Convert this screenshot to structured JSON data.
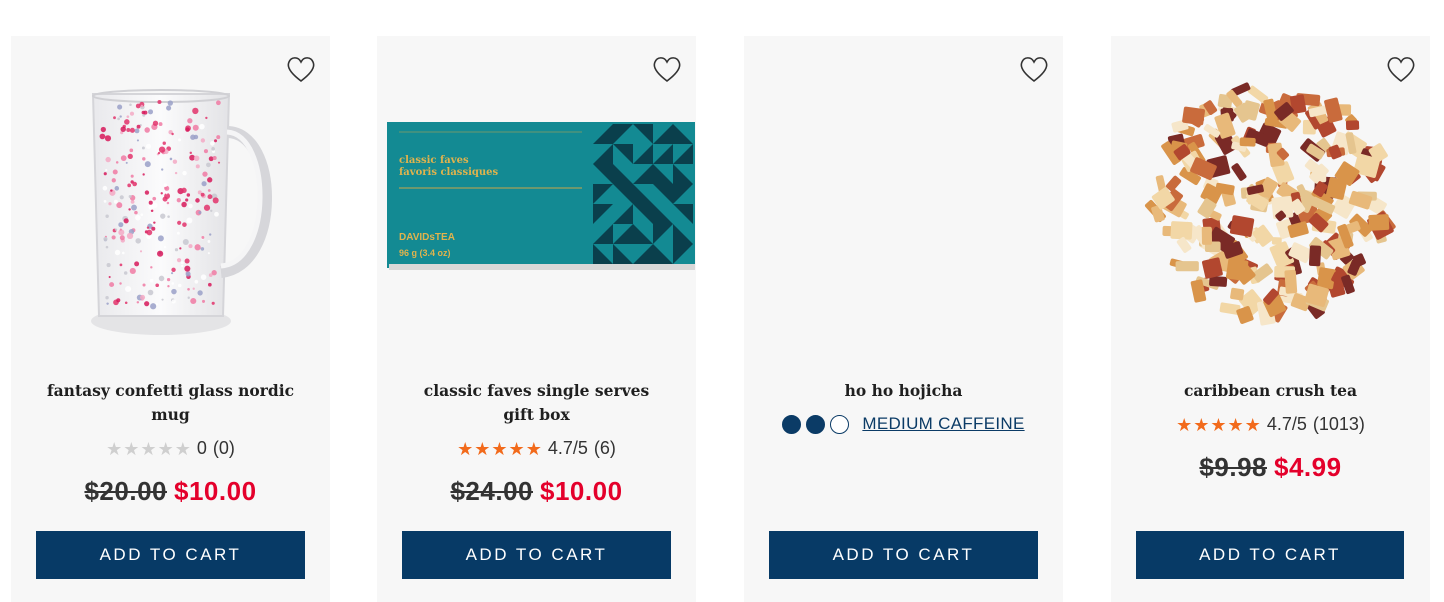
{
  "products": [
    {
      "title": "fantasy confetti glass nordic mug",
      "rating_value": "0",
      "rating_count": "(0)",
      "stars_filled": 0,
      "price_old": "$20.00",
      "price_new": "$10.00",
      "cta": "ADD TO CART",
      "image": "confetti-glass-mug"
    },
    {
      "title": "classic faves single serves gift box",
      "rating_value": "4.7/5",
      "rating_count": "(6)",
      "stars_filled": 4.7,
      "price_old": "$24.00",
      "price_new": "$10.00",
      "cta": "ADD TO CART",
      "image": "teal-gift-box",
      "box_title": "classic faves\nfavoris classiques",
      "box_brand": "DAVIDsTEA",
      "box_weight": "96 g (3.4 oz)"
    },
    {
      "title": "ho ho hojicha",
      "caffeine_label": "MEDIUM CAFFEINE",
      "caffeine_level": 2,
      "caffeine_max": 3,
      "cta": "ADD TO CART"
    },
    {
      "title": "caribbean crush tea",
      "rating_value": "4.7/5",
      "rating_count": "(1013)",
      "stars_filled": 4.7,
      "price_old": "$9.98",
      "price_new": "$4.99",
      "cta": "ADD TO CART",
      "image": "loose-leaf-fruit-tea"
    }
  ],
  "colors": {
    "card_bg": "#f7f7f7",
    "button_bg": "#073a66",
    "sale_price": "#e4002b",
    "star": "#f26a1b",
    "caffeine": "#0b3b66"
  },
  "icons": {
    "wishlist": "heart-outline-icon",
    "star": "star-icon"
  }
}
